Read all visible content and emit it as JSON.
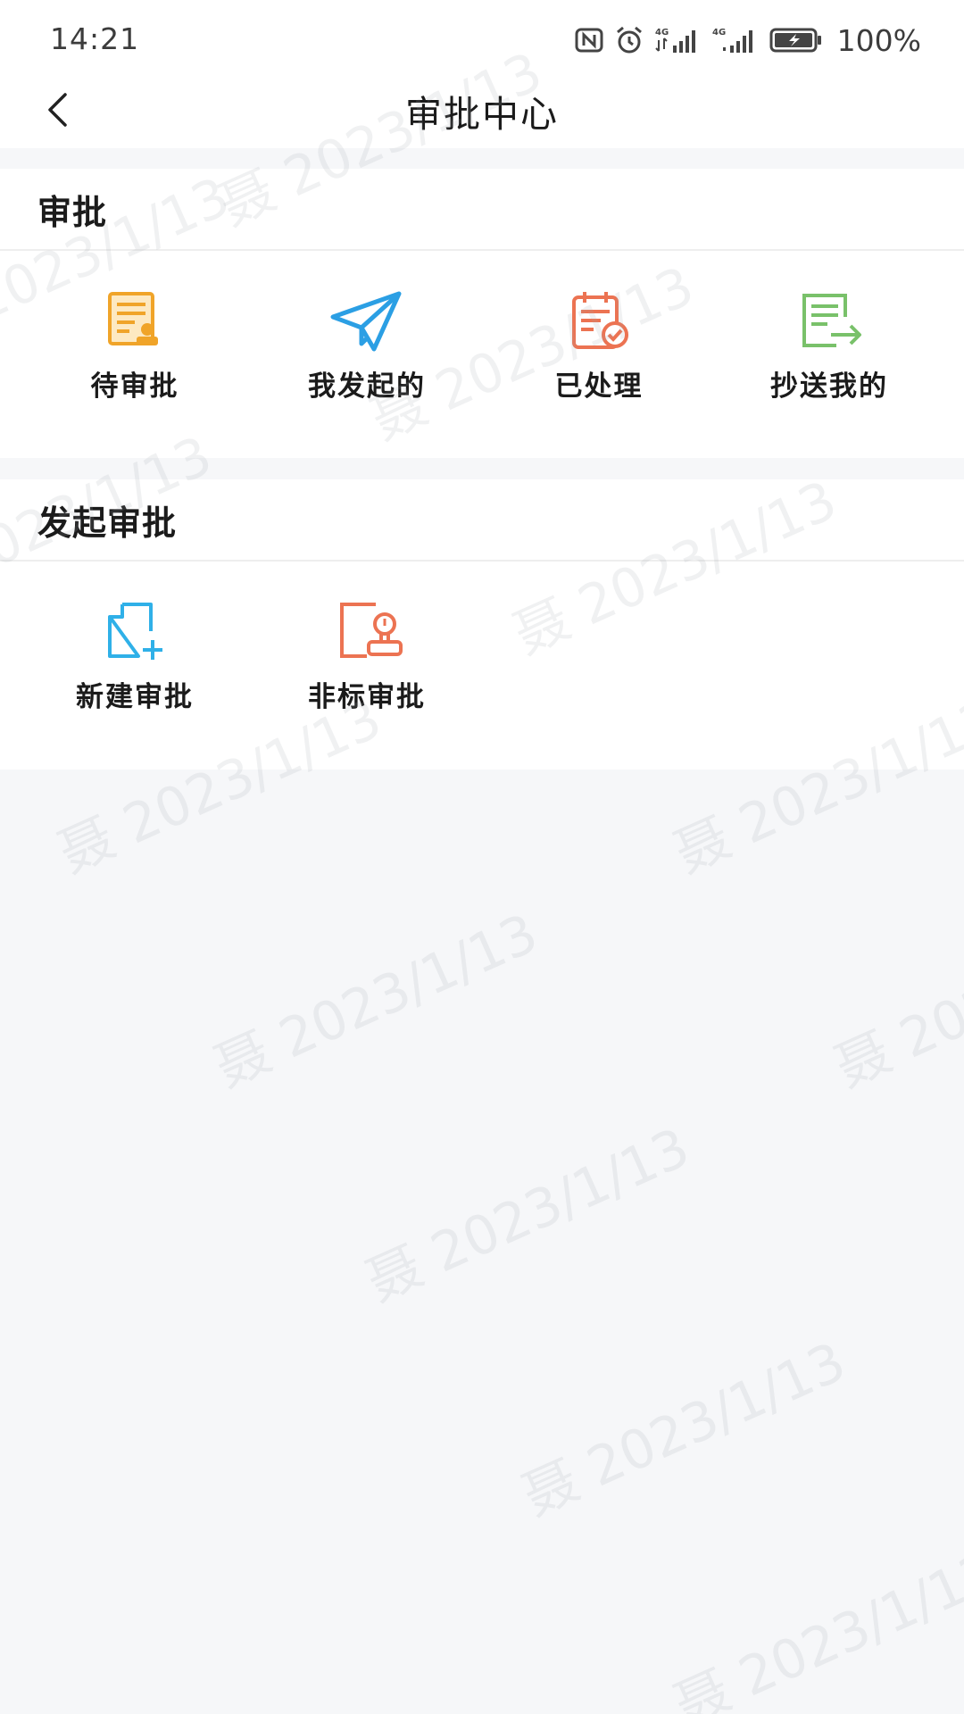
{
  "status_bar": {
    "time": "14:21",
    "icons": [
      "nfc-icon",
      "alarm-icon",
      "signal-4g-icon",
      "signal-4g-icon",
      "battery-charging-icon"
    ],
    "battery": "100%"
  },
  "nav": {
    "title": "审批中心",
    "back_icon": "chevron-left-icon"
  },
  "sections": [
    {
      "title": "审批",
      "items": [
        {
          "label": "待审批",
          "icon": "pending-approval-icon",
          "color": "#f0a429"
        },
        {
          "label": "我发起的",
          "icon": "paper-plane-icon",
          "color": "#2b9fe4"
        },
        {
          "label": "已处理",
          "icon": "calendar-check-icon",
          "color": "#ec7352"
        },
        {
          "label": "抄送我的",
          "icon": "document-forward-icon",
          "color": "#79c16a"
        }
      ]
    },
    {
      "title": "发起审批",
      "items": [
        {
          "label": "新建审批",
          "icon": "new-document-icon",
          "color": "#2fb0e8"
        },
        {
          "label": "非标审批",
          "icon": "stamp-icon",
          "color": "#ec7352"
        }
      ]
    }
  ],
  "watermark": {
    "text": "聂 2023/1/13"
  },
  "colors": {
    "background": "#f6f7f9",
    "card": "#ffffff",
    "text": "#1b1b1b"
  }
}
